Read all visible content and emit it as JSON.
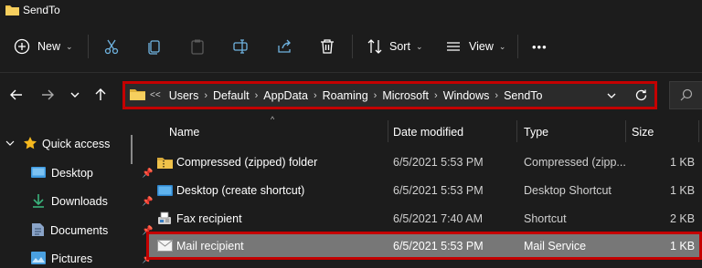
{
  "window": {
    "title": "SendTo"
  },
  "toolbar": {
    "new_label": "New",
    "sort_label": "Sort",
    "view_label": "View",
    "more_label": "•••"
  },
  "address": {
    "overflow": "<<",
    "crumbs": [
      "Users",
      "Default",
      "AppData",
      "Roaming",
      "Microsoft",
      "Windows",
      "SendTo"
    ]
  },
  "sidebar": {
    "items": [
      {
        "label": "Quick access",
        "icon": "star-icon"
      },
      {
        "label": "Desktop",
        "icon": "desktop-folder-icon"
      },
      {
        "label": "Downloads",
        "icon": "download-icon"
      },
      {
        "label": "Documents",
        "icon": "documents-icon"
      },
      {
        "label": "Pictures",
        "icon": "pictures-icon"
      }
    ]
  },
  "columns": {
    "name": "Name",
    "date": "Date modified",
    "type": "Type",
    "size": "Size"
  },
  "files": [
    {
      "name": "Compressed (zipped) folder",
      "date": "6/5/2021 5:53 PM",
      "type": "Compressed (zipp...",
      "size": "1 KB",
      "icon": "zip-folder-icon"
    },
    {
      "name": "Desktop (create shortcut)",
      "date": "6/5/2021 5:53 PM",
      "type": "Desktop Shortcut",
      "size": "1 KB",
      "icon": "desktop-icon"
    },
    {
      "name": "Fax recipient",
      "date": "6/5/2021 7:40 AM",
      "type": "Shortcut",
      "size": "2 KB",
      "icon": "fax-icon"
    },
    {
      "name": "Mail recipient",
      "date": "6/5/2021 5:53 PM",
      "type": "Mail Service",
      "size": "1 KB",
      "icon": "mail-icon"
    }
  ],
  "colors": {
    "highlight": "#c40000",
    "selection": "#777777",
    "folder": "#f0c24a",
    "background": "#1c1c1c"
  }
}
